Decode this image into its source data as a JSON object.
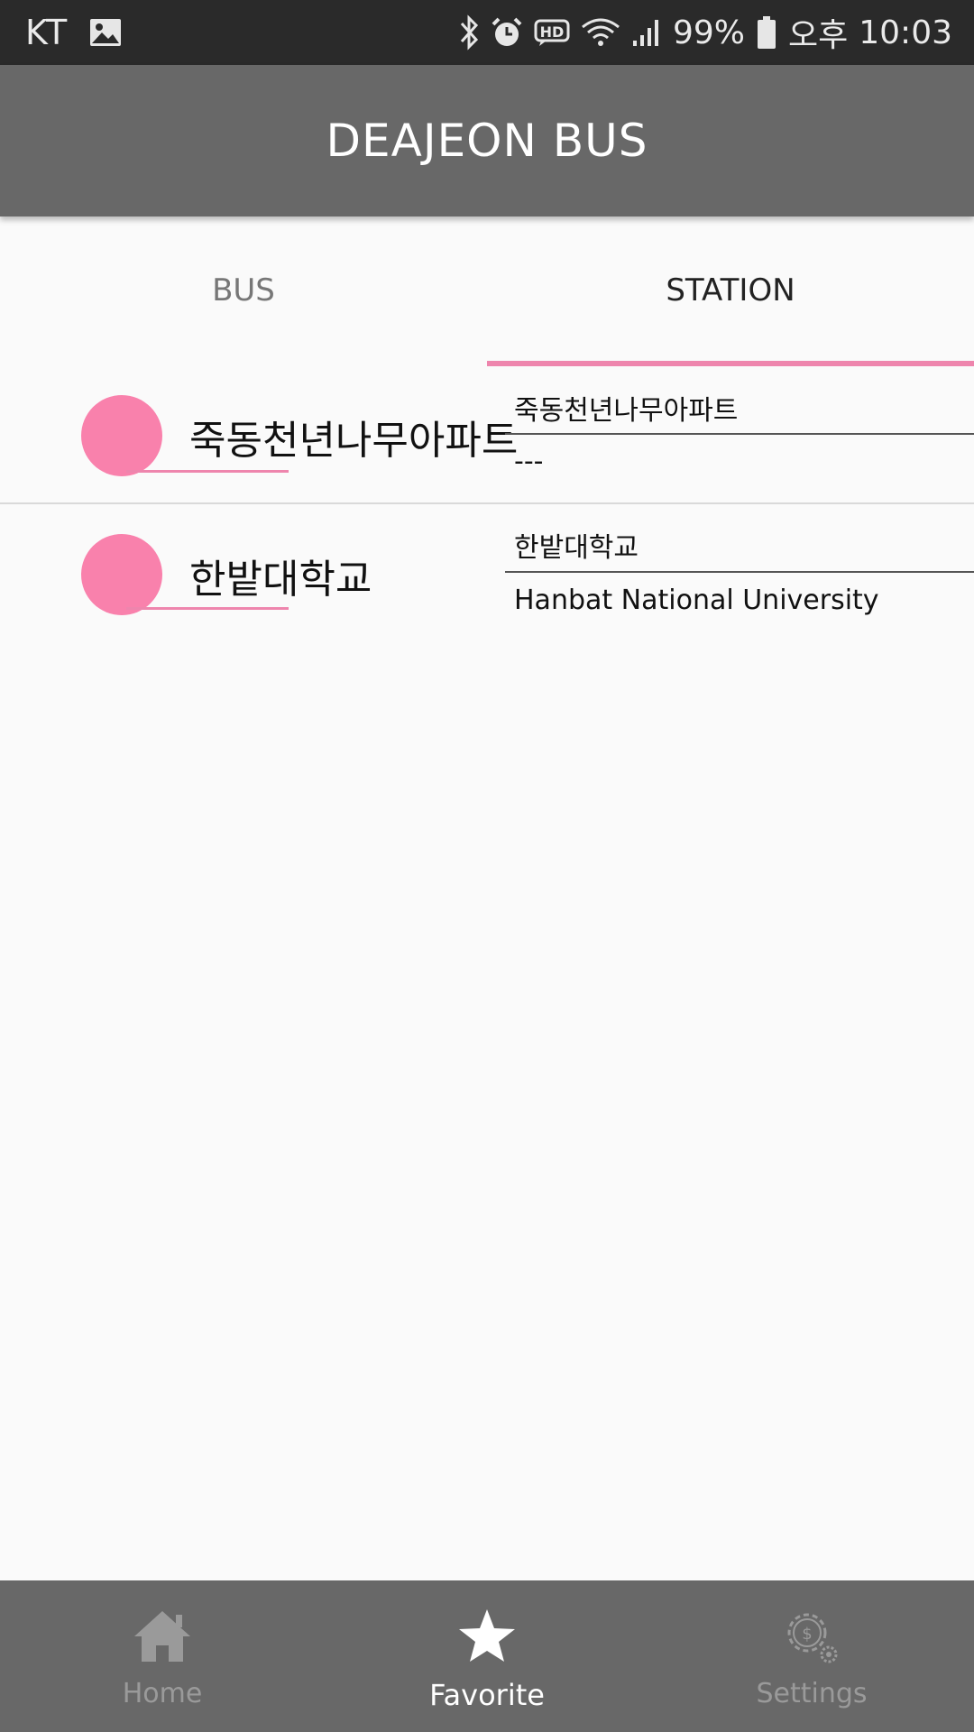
{
  "status_bar": {
    "carrier": "KT",
    "battery": "99%",
    "ampm": "오후",
    "time": "10:03",
    "icons": [
      "image-icon",
      "bluetooth-icon",
      "alarm-icon",
      "hd-icon",
      "wifi-icon",
      "signal-icon",
      "battery-icon"
    ]
  },
  "app_bar": {
    "title": "DEAJEON BUS"
  },
  "tabs": [
    {
      "label": "BUS",
      "selected": false
    },
    {
      "label": "STATION",
      "selected": true
    }
  ],
  "colors": {
    "accent": "#ee85ad",
    "dot": "#f981ac",
    "bar": "#686868",
    "status": "#2a2a2a"
  },
  "stations": [
    {
      "title": "죽동천년나무아파트",
      "detail_top": "죽동천년나무아파트",
      "detail_bottom": "---"
    },
    {
      "title": "한밭대학교",
      "detail_top": "한밭대학교",
      "detail_bottom": "Hanbat National University"
    }
  ],
  "bottom_nav": [
    {
      "label": "Home",
      "icon": "home-icon",
      "active": false
    },
    {
      "label": "Favorite",
      "icon": "star-icon",
      "active": true
    },
    {
      "label": "Settings",
      "icon": "settings-gear-icon",
      "active": false
    }
  ]
}
